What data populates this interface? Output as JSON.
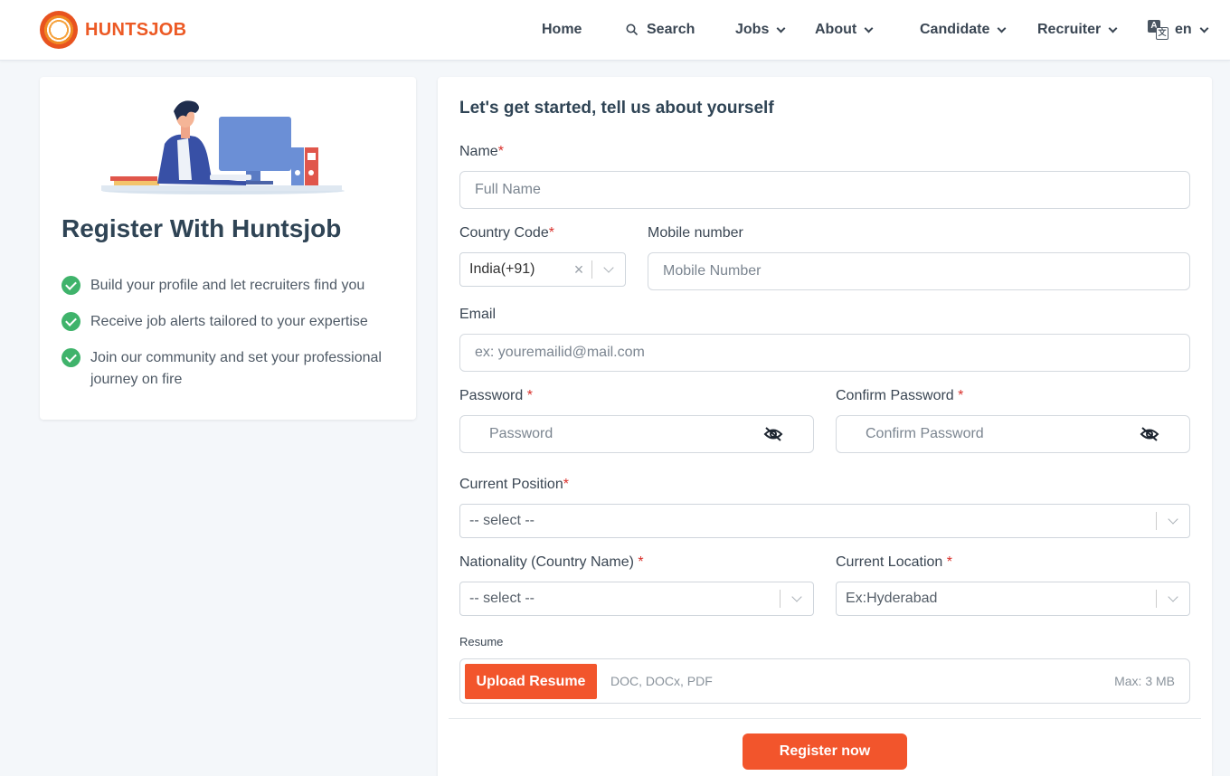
{
  "brand": {
    "name": "HUNTSJOB"
  },
  "nav": {
    "home": "Home",
    "search": "Search",
    "jobs": "Jobs",
    "about": "About",
    "candidate": "Candidate",
    "recruiter": "Recruiter",
    "language": "en"
  },
  "left": {
    "title": "Register With Huntsjob",
    "benefits": [
      "Build your profile and let recruiters find you",
      "Receive job alerts tailored to your expertise",
      "Join our community and set your professional journey on fire"
    ]
  },
  "form": {
    "title": "Let's get started, tell us about yourself",
    "name": {
      "label": "Name",
      "required_mark": "*",
      "placeholder": "Full Name"
    },
    "country_code": {
      "label": "Country Code",
      "required_mark": "*",
      "value": "India(+91)"
    },
    "mobile": {
      "label": "Mobile number",
      "placeholder": "Mobile Number"
    },
    "email": {
      "label": "Email",
      "placeholder": "ex: youremailid@mail.com"
    },
    "password": {
      "label": "Password",
      "required_mark": "*",
      "placeholder": "Password"
    },
    "confirm_password": {
      "label": "Confirm Password",
      "required_mark": "*",
      "placeholder": "Confirm Password"
    },
    "current_position": {
      "label": "Current Position",
      "required_mark": "*",
      "value": "-- select --"
    },
    "nationality": {
      "label": "Nationality (Country Name)",
      "required_mark": "*",
      "value": "-- select --"
    },
    "current_location": {
      "label": "Current Location",
      "required_mark": "*",
      "value": "Ex:Hyderabad"
    },
    "resume": {
      "label": "Resume",
      "button": "Upload Resume",
      "formats": "DOC, DOCx, PDF",
      "max": "Max: 3 MB"
    },
    "submit": "Register now"
  },
  "colors": {
    "accent": "#f2552c",
    "check": "#3fb36b",
    "required": "#d9302b"
  }
}
